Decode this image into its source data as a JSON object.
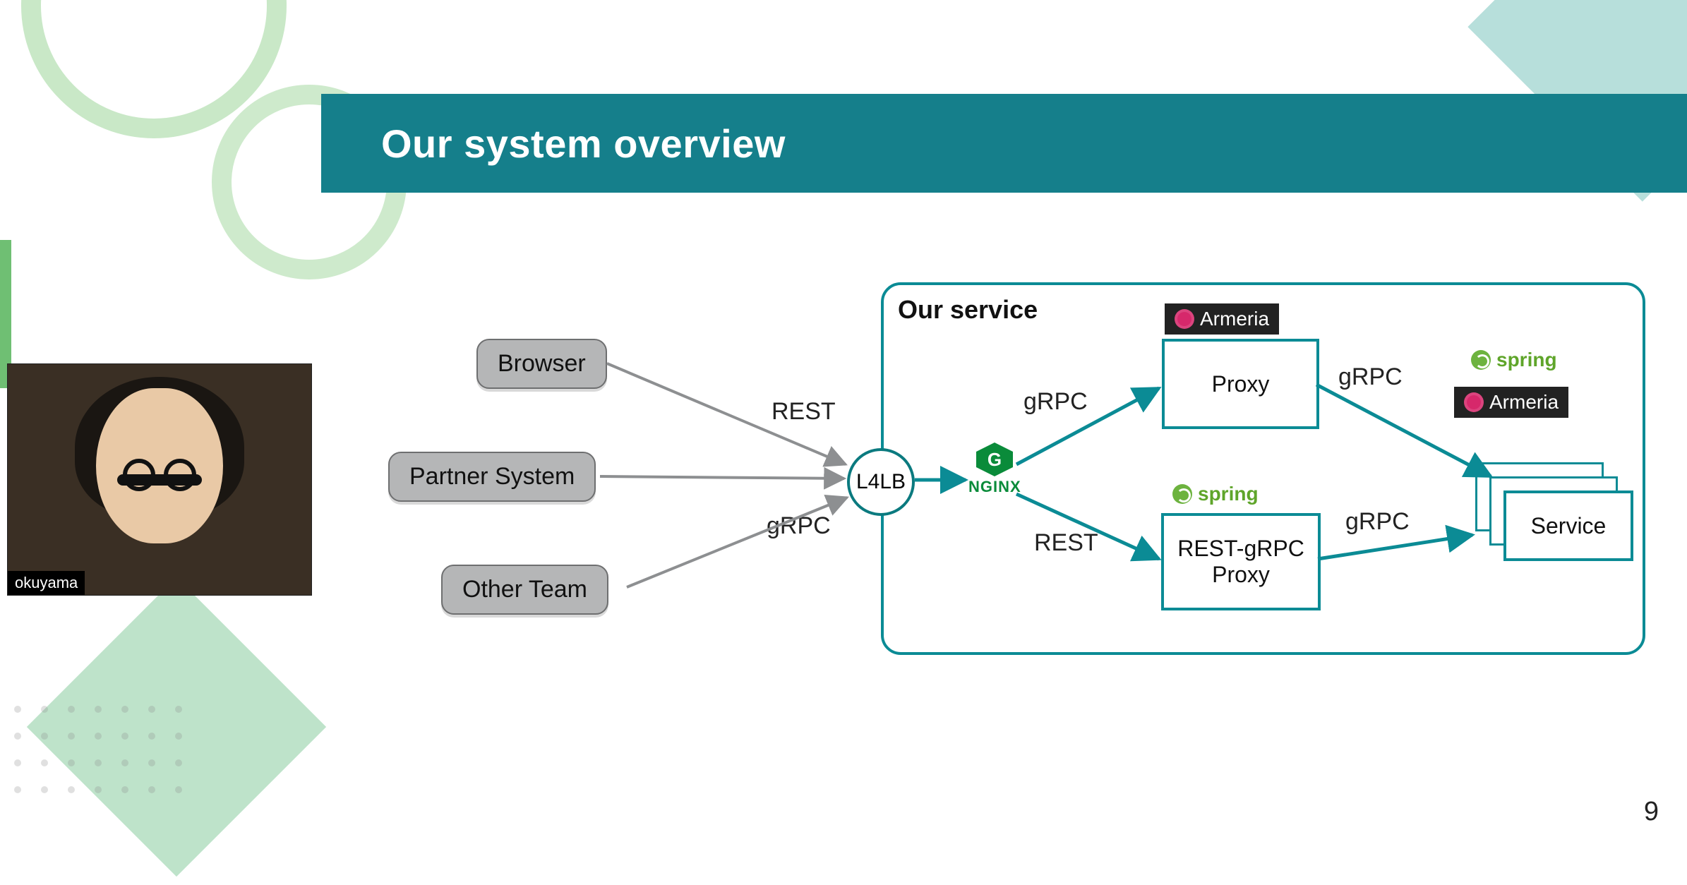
{
  "slide": {
    "title": "Our system overview",
    "page_number": "9"
  },
  "presenter": {
    "name_tag": "okuyama"
  },
  "diagram": {
    "clients": {
      "browser": "Browser",
      "partner": "Partner System",
      "other_team": "Other Team"
    },
    "protocols": {
      "rest": "REST",
      "grpc": "gRPC"
    },
    "nodes": {
      "l4lb": "L4LB",
      "nginx": "NGINX",
      "proxy": "Proxy",
      "rest_grpc_proxy_line1": "REST-gRPC",
      "rest_grpc_proxy_line2": "Proxy",
      "service": "Service"
    },
    "frame_title": "Our service",
    "badges": {
      "armeria": "Armeria",
      "spring": "spring"
    }
  }
}
